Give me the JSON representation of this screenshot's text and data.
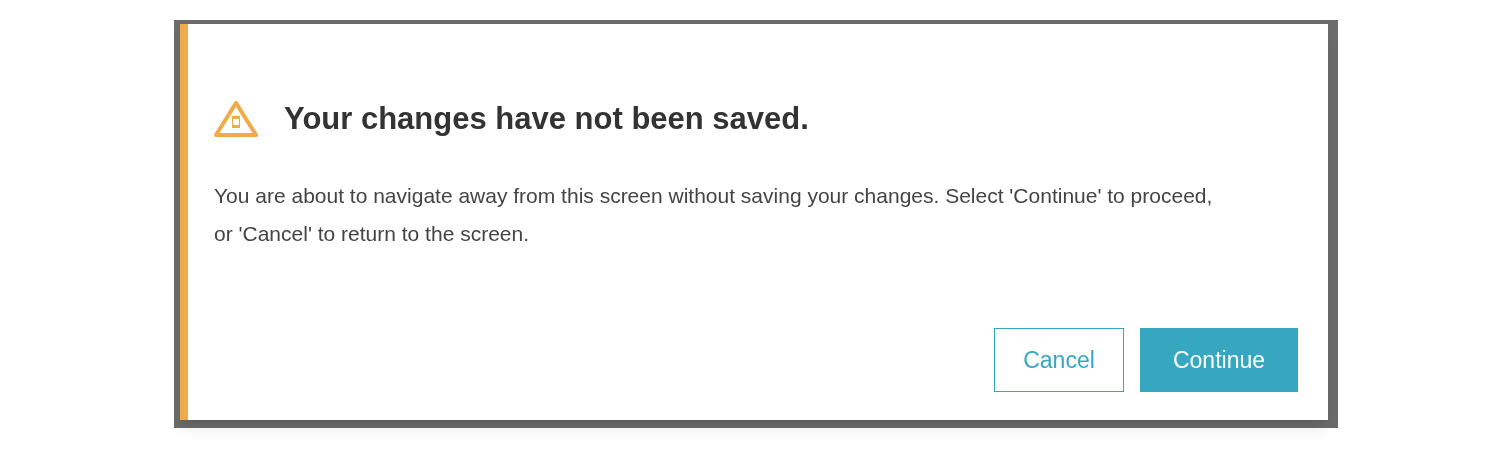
{
  "dialog": {
    "title": "Your changes have not been saved.",
    "message": "You are about to navigate away from this screen without saving your changes. Select 'Continue' to proceed, or 'Cancel' to return to the screen.",
    "buttons": [
      {
        "label": "Cancel",
        "kind": "secondary"
      },
      {
        "label": "Continue",
        "kind": "primary"
      }
    ]
  }
}
